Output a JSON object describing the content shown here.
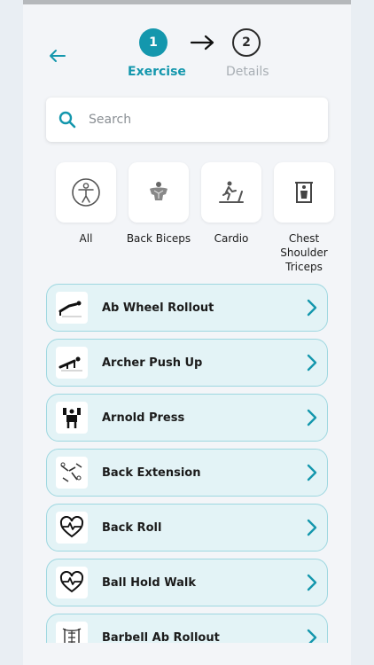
{
  "stepper": {
    "step1_number": "1",
    "step1_label": "Exercise",
    "step2_number": "2",
    "step2_label": "Details"
  },
  "search": {
    "placeholder": "Search"
  },
  "categories": [
    {
      "label": "All",
      "icon": "person-circle-icon"
    },
    {
      "label": "Back Biceps",
      "icon": "back-muscle-icon"
    },
    {
      "label": "Cardio",
      "icon": "treadmill-icon"
    },
    {
      "label": "Chest Shoulder Triceps",
      "icon": "torso-icon"
    }
  ],
  "exercises": [
    {
      "label": "Ab Wheel Rollout",
      "icon": "ab-wheel-figure-icon"
    },
    {
      "label": "Archer Push Up",
      "icon": "pushup-figure-icon"
    },
    {
      "label": "Arnold Press",
      "icon": "press-figure-icon"
    },
    {
      "label": "Back Extension",
      "icon": "extension-figure-icon"
    },
    {
      "label": "Back Roll",
      "icon": "heart-pulse-icon"
    },
    {
      "label": "Ball Hold Walk",
      "icon": "heart-pulse-icon"
    },
    {
      "label": "Barbell Ab Rollout",
      "icon": "abs-figure-icon"
    }
  ],
  "colors": {
    "accent": "#1497ad",
    "row_bg": "#e3f3f6",
    "row_border": "#9ed7e0",
    "inactive": "#a8aeb4"
  }
}
